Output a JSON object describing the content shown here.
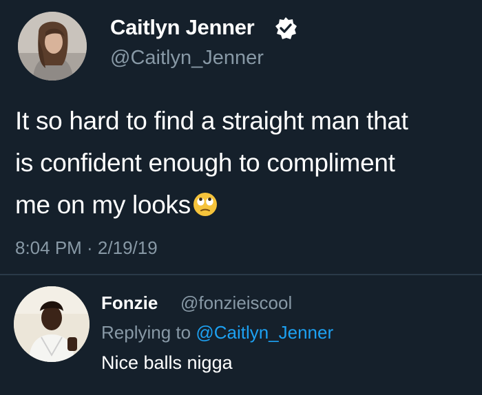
{
  "tweet": {
    "author_name": "Caitlyn Jenner",
    "author_handle": "@Caitlyn_Jenner",
    "text_lines": [
      "It so hard to find a straight man that",
      "is confident enough to compliment",
      "me on my looks"
    ],
    "emoji": "eye-roll-emoji",
    "timestamp": "8:04 PM · 2/19/19"
  },
  "reply": {
    "author_name": "Fonzie",
    "author_handle": "@fonzieiscool",
    "replying_prefix": "Replying to",
    "replying_handle": "@Caitlyn_Jenner",
    "text": "Nice balls nigga"
  },
  "colors": {
    "background": "#15202b",
    "secondary_text": "#8899a6",
    "link": "#1da1f2",
    "divider": "#2a3a48"
  }
}
